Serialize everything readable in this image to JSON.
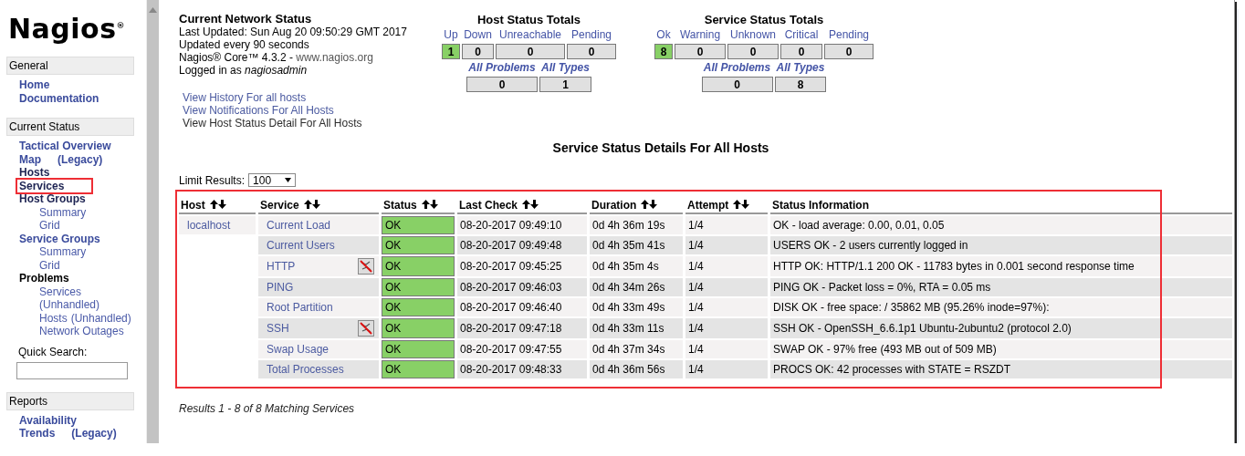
{
  "sidebar": {
    "logo": "Nagios$^{®}$",
    "sections": [
      {
        "title": "General",
        "items": [
          {
            "label": "Home",
            "visited": false,
            "highlighted": false
          },
          {
            "label": "Documentation",
            "visited": false,
            "highlighted": false
          }
        ]
      },
      {
        "title": "Current Status",
        "items": [
          {
            "label": "Tactical Overview",
            "visited": false,
            "highlighted": false
          },
          {
            "label": "Map",
            "note": "(Legacy)",
            "visited": false,
            "highlighted": false
          },
          {
            "label": "Hosts",
            "visited": true,
            "highlighted": false
          },
          {
            "label": "Services",
            "visited": true,
            "highlighted": true
          },
          {
            "label": "Host Groups",
            "visited": true,
            "highlighted": false,
            "children": [
              {
                "label": "Summary"
              },
              {
                "label": "Grid"
              }
            ]
          },
          {
            "label": "Service Groups",
            "visited": false,
            "highlighted": false,
            "children": [
              {
                "label": "Summary"
              },
              {
                "label": "Grid"
              }
            ]
          },
          {
            "label": "Problems",
            "kind": "heading",
            "visited": false,
            "highlighted": false,
            "children": [
              {
                "label": "Services",
                "note": "(Unhandled)",
                "note_break": true
              },
              {
                "label": "Hosts",
                "note": "(Unhandled)",
                "note_break": false
              },
              {
                "label": "Network Outages"
              }
            ]
          }
        ],
        "quick_search": {
          "label": "Quick Search:"
        }
      },
      {
        "title": "Reports",
        "items": [
          {
            "label": "Availability",
            "visited": false,
            "highlighted": false
          },
          {
            "label": "Trends",
            "note": "(Legacy)",
            "visited": false,
            "highlighted": false
          }
        ]
      }
    ]
  },
  "network_status": {
    "title": "Current Network Status",
    "lines": [
      "Last Updated: Sun Aug 20 09:50:29 GMT 2017",
      "Updated every 90 seconds"
    ],
    "version": "Nagios® Core™ 4.3.2 - ",
    "site_link": "www.nagios.org",
    "logged_in_prefix": "Logged in as ",
    "user": "nagiosadmin",
    "links": [
      "View History For all hosts",
      "View Notifications For All Hosts",
      "View Host Status Detail For All Hosts"
    ]
  },
  "host_totals": {
    "title": "Host Status Totals",
    "counters": [
      {
        "label": "Up",
        "value": "1",
        "color": "#88d066"
      },
      {
        "label": "Down",
        "value": "0",
        "color": "#e0e0e0"
      },
      {
        "label": "Unreachable",
        "value": "0",
        "color": "#e0e0e0"
      },
      {
        "label": "Pending",
        "value": "0",
        "color": "#e0e0e0"
      }
    ],
    "summary": [
      {
        "label": "All Problems",
        "value": "0"
      },
      {
        "label": "All Types",
        "value": "1"
      }
    ]
  },
  "service_totals": {
    "title": "Service Status Totals",
    "counters": [
      {
        "label": "Ok",
        "value": "8",
        "color": "#88d066"
      },
      {
        "label": "Warning",
        "value": "0",
        "color": "#e0e0e0"
      },
      {
        "label": "Unknown",
        "value": "0",
        "color": "#e0e0e0"
      },
      {
        "label": "Critical",
        "value": "0",
        "color": "#e0e0e0"
      },
      {
        "label": "Pending",
        "value": "0",
        "color": "#e0e0e0"
      }
    ],
    "summary": [
      {
        "label": "All Problems",
        "value": "0"
      },
      {
        "label": "All Types",
        "value": "8"
      }
    ]
  },
  "details": {
    "title": "Service Status Details For All Hosts",
    "limit_label": "Limit Results:",
    "limit_value": "100",
    "highlighted": true,
    "columns": [
      {
        "label": "Host",
        "sortable": true
      },
      {
        "label": "Service",
        "sortable": true
      },
      {
        "label": "Status",
        "sortable": true
      },
      {
        "label": "Last Check",
        "sortable": true
      },
      {
        "label": "Duration",
        "sortable": true
      },
      {
        "label": "Attempt",
        "sortable": true
      },
      {
        "label": "Status Information",
        "sortable": false
      }
    ],
    "rows": [
      {
        "host": "localhost",
        "service": "Current Load",
        "notifications_disabled": false,
        "status": "OK",
        "last_check": "08-20-2017 09:49:10",
        "duration": "0d 4h 36m 19s",
        "attempt": "1/4",
        "info": "OK - load average: 0.00, 0.01, 0.05"
      },
      {
        "service": "Current Users",
        "notifications_disabled": false,
        "status": "OK",
        "last_check": "08-20-2017 09:49:48",
        "duration": "0d 4h 35m 41s",
        "attempt": "1/4",
        "info": "USERS OK - 2 users currently logged in"
      },
      {
        "service": "HTTP",
        "notifications_disabled": true,
        "status": "OK",
        "last_check": "08-20-2017 09:45:25",
        "duration": "0d 4h 35m 4s",
        "attempt": "1/4",
        "info": "HTTP OK: HTTP/1.1 200 OK - 11783 bytes in 0.001 second response time"
      },
      {
        "service": "PING",
        "notifications_disabled": false,
        "status": "OK",
        "last_check": "08-20-2017 09:46:03",
        "duration": "0d 4h 34m 26s",
        "attempt": "1/4",
        "info": "PING OK - Packet loss = 0%, RTA = 0.05 ms"
      },
      {
        "service": "Root Partition",
        "notifications_disabled": false,
        "status": "OK",
        "last_check": "08-20-2017 09:46:40",
        "duration": "0d 4h 33m 49s",
        "attempt": "1/4",
        "info": "DISK OK - free space: / 35862 MB (95.26% inode=97%):"
      },
      {
        "service": "SSH",
        "notifications_disabled": true,
        "status": "OK",
        "last_check": "08-20-2017 09:47:18",
        "duration": "0d 4h 33m 11s",
        "attempt": "1/4",
        "info": "SSH OK - OpenSSH_6.6.1p1 Ubuntu-2ubuntu2 (protocol 2.0)"
      },
      {
        "service": "Swap Usage",
        "notifications_disabled": false,
        "status": "OK",
        "last_check": "08-20-2017 09:47:55",
        "duration": "0d 4h 37m 34s",
        "attempt": "1/4",
        "info": "SWAP OK - 97% free (493 MB out of 509 MB)"
      },
      {
        "service": "Total Processes",
        "notifications_disabled": false,
        "status": "OK",
        "last_check": "08-20-2017 09:48:33",
        "duration": "0d 4h 36m 56s",
        "attempt": "1/4",
        "info": "PROCS OK: 42 processes with STATE = RSZDT"
      }
    ],
    "results": "Results 1 - 8 of 8 Matching Services"
  }
}
